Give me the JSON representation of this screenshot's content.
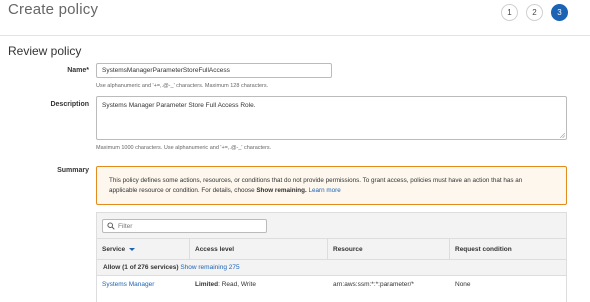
{
  "header": {
    "title": "Create policy",
    "steps": [
      "1",
      "2",
      "3"
    ],
    "active_step": "3"
  },
  "review": {
    "section_title": "Review policy",
    "name": {
      "label": "Name*",
      "value": "SystemsManagerParameterStoreFullAccess",
      "hint": "Use alphanumeric and '+=,.@-_' characters. Maximum 128 characters."
    },
    "description": {
      "label": "Description",
      "value": "Systems Manager Parameter Store Full Access Role.",
      "hint": "Maximum 1000 characters. Use alphanumeric and '+=,.@-_' characters."
    },
    "summary": {
      "label": "Summary",
      "alert": {
        "text_line1": "This policy defines some actions, resources, or conditions that do not provide permissions. To grant access, policies must have an action that has an",
        "text_line2_prefix": "applicable resource or condition. For details, choose ",
        "text_bold": "Show remaining.",
        "link": "Learn more"
      },
      "filter_placeholder": "Filter",
      "columns": [
        "Service",
        "Access level",
        "Resource",
        "Request condition"
      ],
      "group": {
        "label": "Allow (1 of 276 services)",
        "link": "Show remaining 275"
      },
      "rows": [
        {
          "service": "Systems Manager",
          "access_level_bold": "Limited",
          "access_level_rest": ": Read, Write",
          "resource": "arn:aws:ssm:*:*:parameter/*",
          "request_condition": "None"
        }
      ]
    }
  },
  "colors": {
    "accent": "#1c63b4",
    "alert_border": "#e38b1d",
    "alert_bg": "#fdf7ee"
  }
}
